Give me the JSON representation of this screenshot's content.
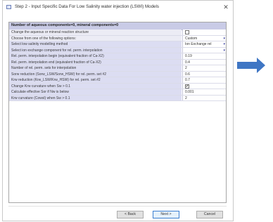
{
  "window": {
    "title": "Step 2 - Input Specific Data For Low Salinity water injection (LSWI) Models",
    "close_glyph": "✕"
  },
  "grid": {
    "header": "Number of aqueous components=0, mineral components=0",
    "rows": [
      {
        "label": "Change the aqueous or mineral reaction structure",
        "type": "checkbox",
        "value": "",
        "shade": "plain"
      },
      {
        "label": "Choose from one of the following options:",
        "type": "dropdown",
        "value": "Custom",
        "shade": "plain"
      },
      {
        "label": "Select low salinity modelling method",
        "type": "dropdown",
        "value": "Ion Exchange rel",
        "shade": "shaded"
      },
      {
        "label": "Select ion exchange component for rel. perm. interpolation",
        "type": "dropdown",
        "value": "",
        "shade": "shaded"
      },
      {
        "label": "Rel. perm. interpolation begin (equivalent fraction of Ca-X2)",
        "type": "text",
        "value": "0.19",
        "shade": "shaded"
      },
      {
        "label": "Rel. perm. interpolation end (equivalent fraction of Ca-X2)",
        "type": "text",
        "value": "0.4",
        "shade": "shaded"
      },
      {
        "label": "Number of rel. perm. sets for interpolation",
        "type": "text",
        "value": "2",
        "shade": "shaded"
      },
      {
        "label": "Sorw reduction (Sorw_LSW/Sorw_HSW) for rel. perm. set #2",
        "type": "text",
        "value": "0.6",
        "shade": "shaded"
      },
      {
        "label": "Krw reduction (Krw_LSW/Krw_HSW) for rel. perm. set #2",
        "type": "text",
        "value": "0.7",
        "shade": "shaded"
      },
      {
        "label": "Change Krw curvature when Sw > 0.1",
        "type": "checkbox",
        "value": "✔",
        "shade": "shaded"
      },
      {
        "label": "Calculate effective Sor if Nw is below",
        "type": "text",
        "value": "0.001",
        "shade": "shaded"
      },
      {
        "label": "Krw curvature (Cowsl) when Sw > 0.1",
        "type": "text",
        "value": "2",
        "shade": "shaded"
      }
    ]
  },
  "buttons": {
    "back": "< Back",
    "next": "Next >",
    "cancel": "Cancel"
  },
  "colors": {
    "arrow": "#3f76c4",
    "header_bg": "#c9cbe6",
    "row_shaded": "#dcddf2"
  }
}
